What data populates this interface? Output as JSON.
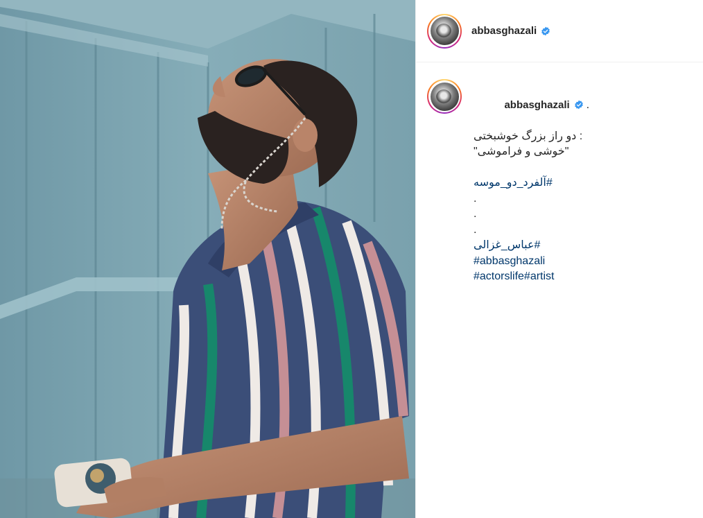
{
  "post": {
    "image": {
      "alt": "",
      "colors": {
        "wall": "#7fa6b2",
        "shirt_navy": "#3b4e78",
        "stripe_green": "#17876b",
        "stripe_pink": "#c58f95",
        "stripe_white": "#efeae6",
        "skin": "#b27f64",
        "hair": "#2a2220"
      }
    },
    "header": {
      "username": "abbasghazali",
      "verified": true,
      "verified_icon": "verified-badge-icon",
      "avatar_icon": "profile-avatar"
    },
    "caption": {
      "username": "abbasghazali",
      "verified": true,
      "first_line_suffix": ".",
      "lines": [
        {
          "kind": "text",
          "dir": "rtl",
          "text": ": دو راز بزرگ خوشبختی"
        },
        {
          "kind": "text",
          "dir": "rtl",
          "text": "\"خوشی و فراموشی\""
        },
        {
          "kind": "blank",
          "text": ""
        },
        {
          "kind": "tag",
          "dir": "rtl",
          "text": "#آلفرد_دو_موسه"
        },
        {
          "kind": "text",
          "dir": "ltr",
          "text": "."
        },
        {
          "kind": "text",
          "dir": "ltr",
          "text": "."
        },
        {
          "kind": "text",
          "dir": "ltr",
          "text": "."
        },
        {
          "kind": "tag",
          "dir": "rtl",
          "text": "#عباس_غزالی"
        },
        {
          "kind": "tag",
          "dir": "ltr",
          "text": "#abbasghazali"
        },
        {
          "kind": "tag",
          "dir": "ltr",
          "text": "#actorslife#artist"
        }
      ]
    },
    "accent": "#0095f6",
    "hashtag_color": "#00376b"
  }
}
